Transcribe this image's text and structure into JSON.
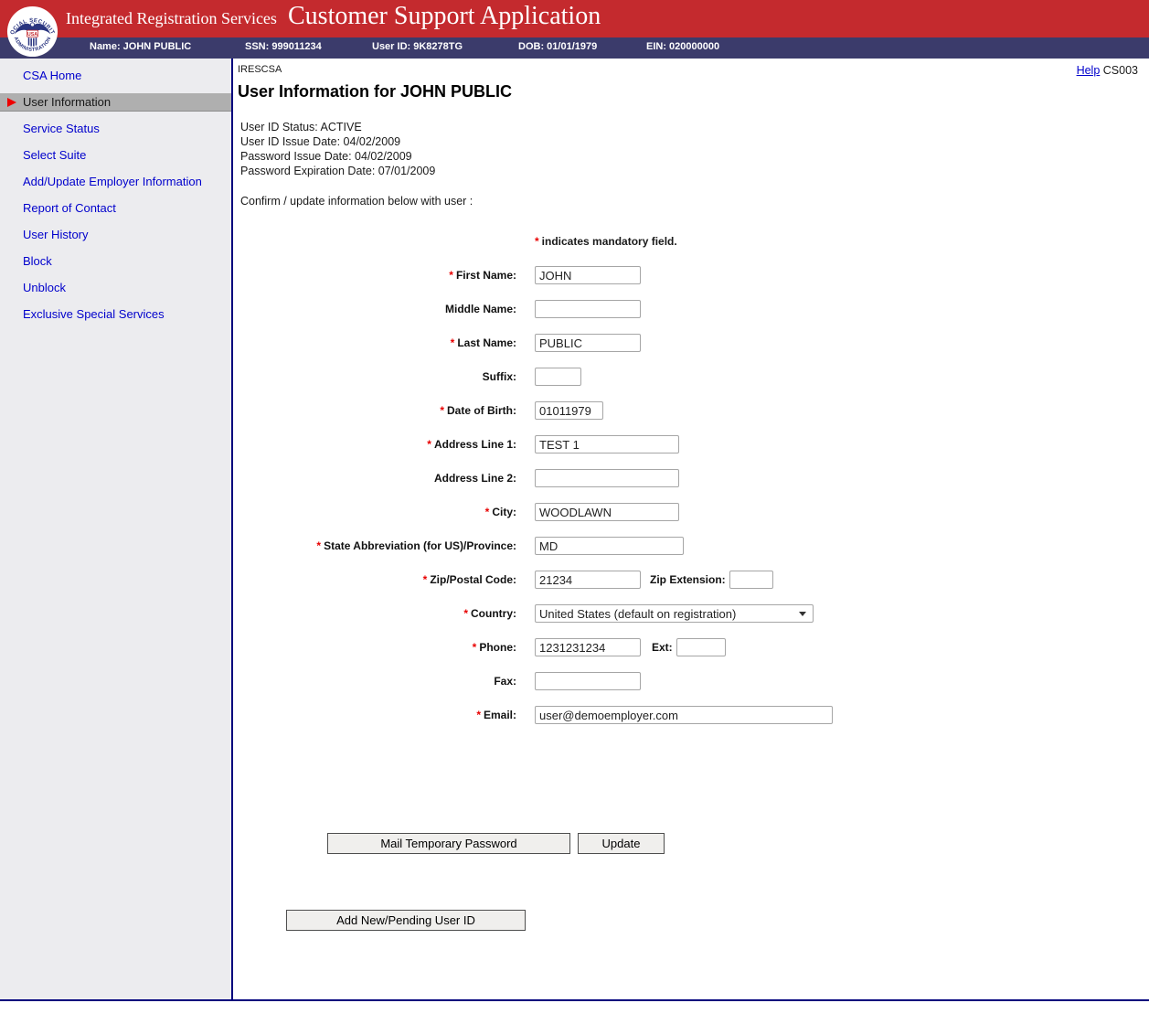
{
  "symbols": {
    "required": "*"
  },
  "header": {
    "brand": "Integrated Registration Services",
    "title": "Customer Support Application",
    "seal": {
      "top_text": "SOCIAL SECURITY",
      "bottom_text": "ADMINISTRATION",
      "center_text": "USA"
    }
  },
  "user_bar": {
    "name": "Name: JOHN PUBLIC",
    "ssn": "SSN: 999011234",
    "user_id": "User ID: 9K8278TG",
    "dob": "DOB: 01/01/1979",
    "ein": "EIN: 020000000"
  },
  "sidebar": {
    "items": [
      {
        "label": "CSA Home"
      },
      {
        "label": "User Information",
        "selected": true
      },
      {
        "label": "Service Status"
      },
      {
        "label": "Select Suite"
      },
      {
        "label": "Add/Update Employer Information"
      },
      {
        "label": "Report of Contact"
      },
      {
        "label": "User History"
      },
      {
        "label": "Block"
      },
      {
        "label": "Unblock"
      },
      {
        "label": "Exclusive Special Services"
      }
    ]
  },
  "main": {
    "app_code": "IRESCSA",
    "help_label": "Help",
    "page_code": "CS003",
    "heading": "User Information for JOHN PUBLIC",
    "status_lines": [
      "User ID Status: ACTIVE",
      "User ID Issue Date: 04/02/2009",
      "Password Issue Date: 04/02/2009",
      "Password Expiration Date: 07/01/2009"
    ],
    "confirm_text": "Confirm / update information below with user :",
    "mandatory_note": "indicates mandatory field.",
    "form": {
      "first_name": {
        "label": "First Name:",
        "value": "JOHN"
      },
      "middle_name": {
        "label": "Middle Name:",
        "value": ""
      },
      "last_name": {
        "label": "Last Name:",
        "value": "PUBLIC"
      },
      "suffix": {
        "label": "Suffix:",
        "value": ""
      },
      "dob": {
        "label": "Date of Birth:",
        "value": "01011979"
      },
      "address1": {
        "label": "Address Line 1:",
        "value": "TEST 1"
      },
      "address2": {
        "label": "Address Line 2:",
        "value": ""
      },
      "city": {
        "label": "City:",
        "value": "WOODLAWN"
      },
      "state": {
        "label": "State Abbreviation (for US)/Province:",
        "value": "MD"
      },
      "zip": {
        "label": "Zip/Postal Code:",
        "value": "21234"
      },
      "zip_ext": {
        "label": "Zip Extension:",
        "value": ""
      },
      "country": {
        "label": "Country:",
        "value": "United States (default on registration)"
      },
      "phone": {
        "label": "Phone:",
        "value": "1231231234"
      },
      "ext": {
        "label": "Ext:",
        "value": ""
      },
      "fax": {
        "label": "Fax:",
        "value": ""
      },
      "email": {
        "label": "Email:",
        "value": "user@demoemployer.com"
      }
    },
    "buttons": {
      "mail_temp_password": "Mail Temporary Password",
      "update": "Update",
      "add_new_pending": "Add New/Pending User ID"
    }
  }
}
